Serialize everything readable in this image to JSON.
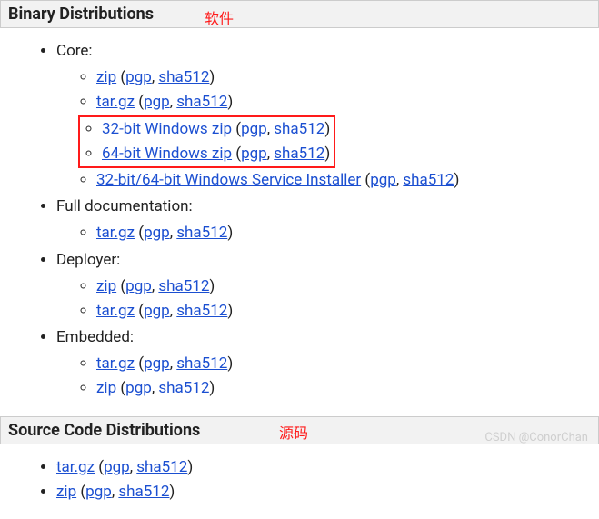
{
  "sections": {
    "binary": {
      "title": "Binary Distributions",
      "annotation": "软件",
      "groups": [
        {
          "label": "Core:",
          "items": [
            {
              "name": "zip",
              "pgp": "pgp",
              "sha": "sha512"
            },
            {
              "name": "tar.gz",
              "pgp": "pgp",
              "sha": "sha512"
            },
            {
              "name": "32-bit Windows zip",
              "pgp": "pgp",
              "sha": "sha512",
              "highlight": true
            },
            {
              "name": "64-bit Windows zip",
              "pgp": "pgp",
              "sha": "sha512",
              "highlight": true
            },
            {
              "name": "32-bit/64-bit Windows Service Installer",
              "pgp": "pgp",
              "sha": "sha512"
            }
          ]
        },
        {
          "label": "Full documentation:",
          "items": [
            {
              "name": "tar.gz",
              "pgp": "pgp",
              "sha": "sha512"
            }
          ]
        },
        {
          "label": "Deployer:",
          "items": [
            {
              "name": "zip",
              "pgp": "pgp",
              "sha": "sha512"
            },
            {
              "name": "tar.gz",
              "pgp": "pgp",
              "sha": "sha512"
            }
          ]
        },
        {
          "label": "Embedded:",
          "items": [
            {
              "name": "tar.gz",
              "pgp": "pgp",
              "sha": "sha512"
            },
            {
              "name": "zip",
              "pgp": "pgp",
              "sha": "sha512"
            }
          ]
        }
      ]
    },
    "source": {
      "title": "Source Code Distributions",
      "annotation": "源码",
      "items": [
        {
          "name": "tar.gz",
          "pgp": "pgp",
          "sha": "sha512"
        },
        {
          "name": "zip",
          "pgp": "pgp",
          "sha": "sha512"
        }
      ]
    }
  },
  "watermark": "CSDN @ConorChan"
}
